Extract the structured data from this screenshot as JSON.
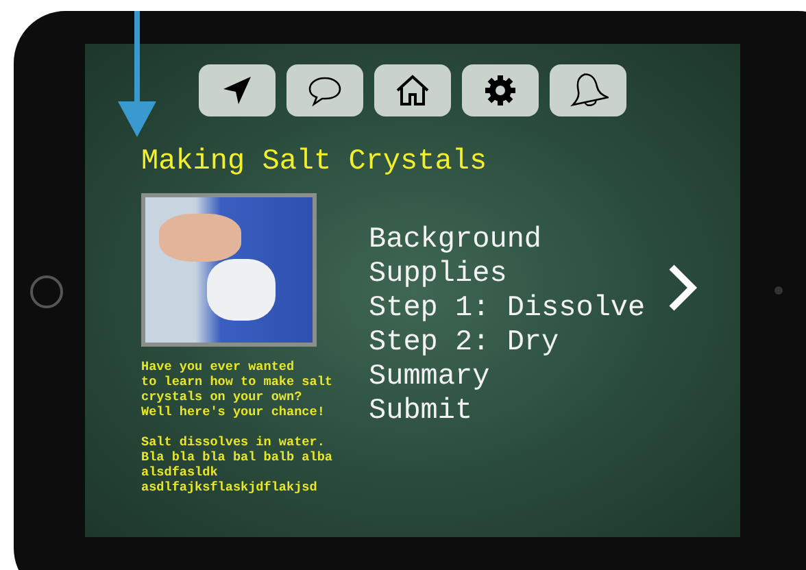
{
  "toolbar": [
    {
      "kind": "navigate"
    },
    {
      "kind": "chat"
    },
    {
      "kind": "home"
    },
    {
      "kind": "settings"
    },
    {
      "kind": "bell"
    }
  ],
  "title": "Making Salt Crystals",
  "intro": [
    "Have you ever wanted\nto learn how to make salt\ncrystals on your own?\nWell here's your chance!",
    "Salt dissolves in water.\nBla bla bla bal balb alba\nalsdfasldk\nasdlfajksflaskjdflakjsd"
  ],
  "menu": [
    "Background",
    "Supplies",
    "Step 1: Dissolve",
    "Step 2: Dry",
    "Summary",
    "Submit"
  ]
}
